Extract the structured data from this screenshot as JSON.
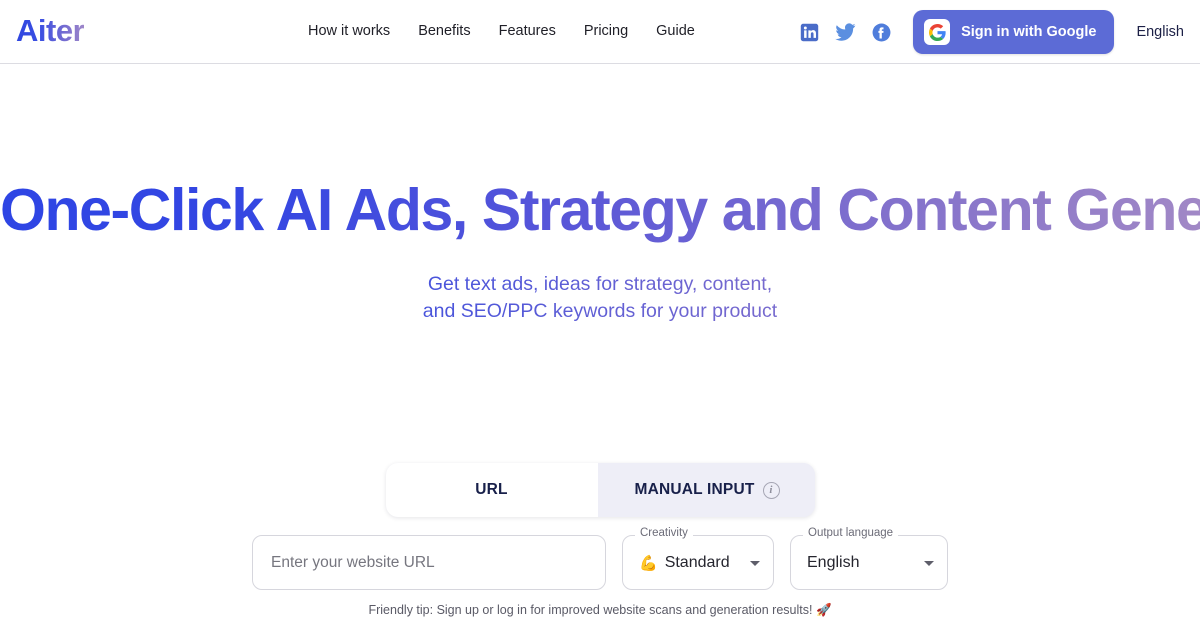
{
  "brand": {
    "name": "Aiter"
  },
  "nav": {
    "items": [
      {
        "label": "How it works"
      },
      {
        "label": "Benefits"
      },
      {
        "label": "Features"
      },
      {
        "label": "Pricing"
      },
      {
        "label": "Guide"
      }
    ]
  },
  "header": {
    "socials": [
      {
        "name": "linkedin-icon",
        "color": "#4a6cc8"
      },
      {
        "name": "twitter-icon",
        "color": "#5b8fe0"
      },
      {
        "name": "facebook-icon",
        "color": "#4f7ddb"
      }
    ],
    "google_button": {
      "label": "Sign in with Google",
      "background": "#5c6bd6"
    },
    "language": {
      "label": "English"
    }
  },
  "hero": {
    "headline": "One-Click AI Ads, Strategy and Content Generator",
    "subhead_line1": "Get text ads, ideas for strategy, content,",
    "subhead_line2": "and SEO/PPC keywords for your product",
    "gradient_from": "#2e45e4",
    "gradient_to": "#a188c6"
  },
  "tabs": {
    "url": {
      "label": "URL",
      "active": true
    },
    "manual": {
      "label": "MANUAL INPUT",
      "active": false,
      "info_icon": "i"
    }
  },
  "form": {
    "url_input": {
      "value": "",
      "placeholder": "Enter your website URL"
    },
    "creativity": {
      "legend": "Creativity",
      "emoji": "💪",
      "value": "Standard"
    },
    "output_language": {
      "legend": "Output language",
      "value": "English"
    },
    "tip": "Friendly tip: Sign up or log in for improved website scans and generation results! 🚀"
  }
}
